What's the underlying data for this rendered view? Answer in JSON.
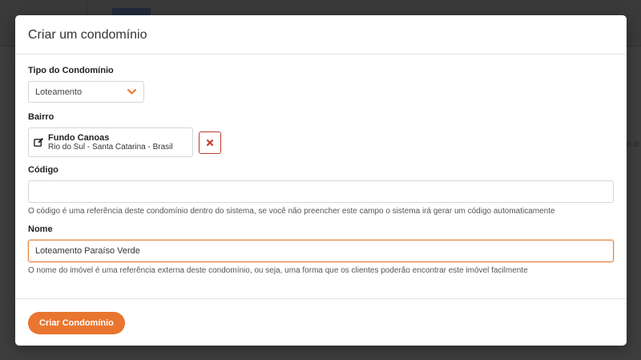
{
  "background": {
    "partial_text": "o d"
  },
  "modal": {
    "title": "Criar um condomínio"
  },
  "form": {
    "tipo": {
      "label": "Tipo do Condomínio",
      "selected": "Loteamento"
    },
    "bairro": {
      "label": "Bairro",
      "name": "Fundo Canoas",
      "location": "Rio do Sul - Santa Catarina - Brasil"
    },
    "codigo": {
      "label": "Código",
      "value": "",
      "help": "O código é uma referência deste condomínio dentro do sistema, se você não preencher este campo o sistema irá gerar um código automaticamente"
    },
    "nome": {
      "label": "Nome",
      "value": "Loteamento Paraíso Verde",
      "help": "O nome do imóvel é uma referência externa deste condomínio, ou seja, uma forma que os clientes poderão encontrar este imóvel facilmente"
    }
  },
  "footer": {
    "submit_label": "Criar Condomínio"
  },
  "colors": {
    "accent": "#e9752f",
    "danger": "#c0392b",
    "focus_border": "#e8833a"
  },
  "icons": {
    "select_arrow": "chevron-down-icon",
    "bairro_edit": "edit-icon",
    "remove": "close-icon"
  }
}
